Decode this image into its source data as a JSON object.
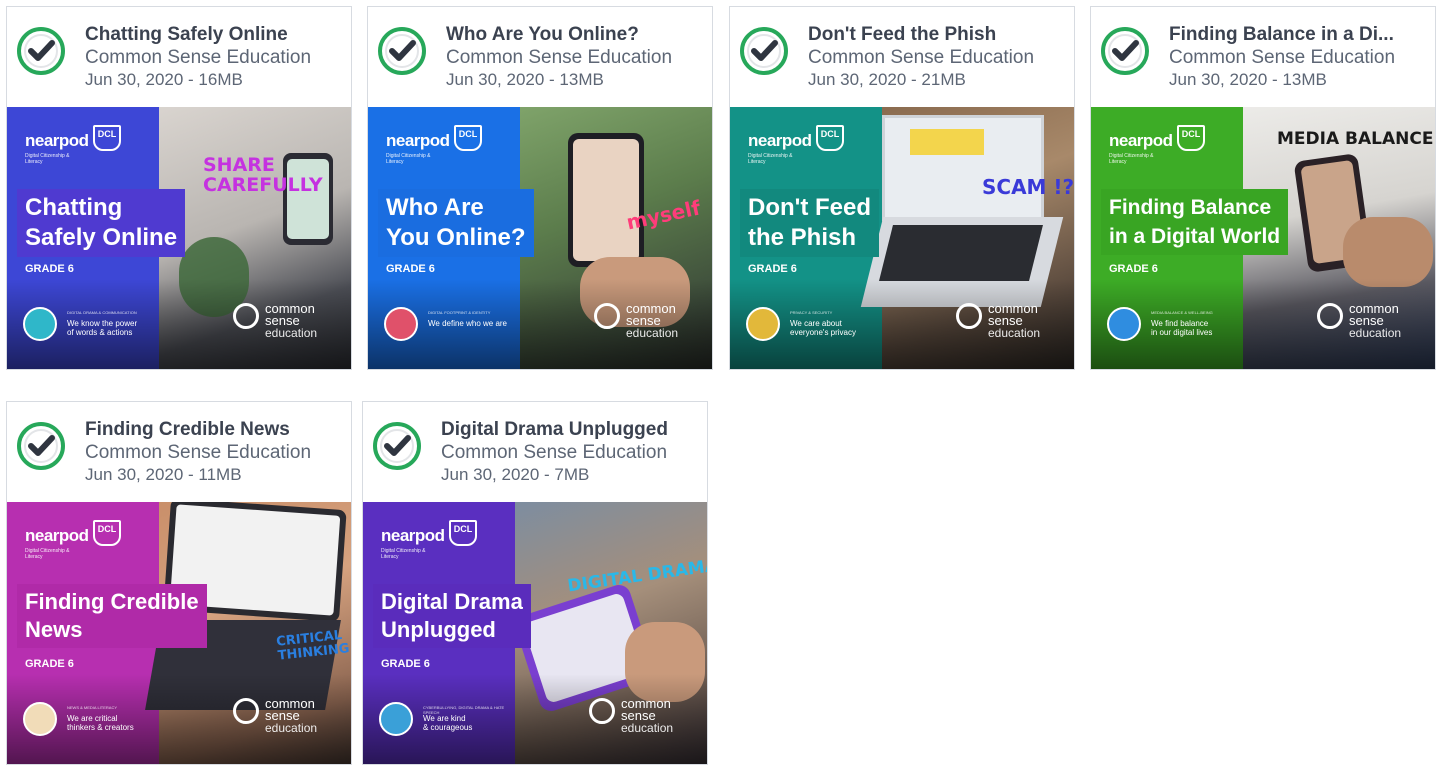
{
  "cards": [
    {
      "title": "Chatting Safely Online",
      "publisher": "Common Sense Education",
      "meta": "Jun 30, 2020 - 16MB",
      "thumb": {
        "brand": "nearpod",
        "badge": "DCL",
        "brand_sub": "Digital Citizenship & Literacy",
        "lesson_title": "Chatting\nSafely Online",
        "grade": "GRADE 6",
        "value_topic": "DIGITAL DRAMA & COMMUNICATION",
        "value_text": "We know the power\nof words & actions",
        "sticker": "SHARE\nCAREFULLY",
        "cs_logo": "common\nsense",
        "cs_sub": "education",
        "panel_color": "#3d47d6",
        "label_color": "#4f3ad0",
        "sticker_color": "#c532e0"
      }
    },
    {
      "title": "Who Are You Online?",
      "publisher": "Common Sense Education",
      "meta": "Jun 30, 2020 - 13MB",
      "thumb": {
        "brand": "nearpod",
        "badge": "DCL",
        "brand_sub": "Digital Citizenship & Literacy",
        "lesson_title": "Who Are\nYou Online?",
        "grade": "GRADE 6",
        "value_topic": "DIGITAL FOOTPRINT & IDENTITY",
        "value_text": "We define who we are",
        "sticker": "myself",
        "cs_logo": "common\nsense",
        "cs_sub": "education",
        "panel_color": "#1a70e6",
        "label_color": "#1a6de0",
        "sticker_color": "#ff3c7a"
      }
    },
    {
      "title": "Don't Feed the Phish",
      "publisher": "Common Sense Education",
      "meta": "Jun 30, 2020 - 21MB",
      "thumb": {
        "brand": "nearpod",
        "badge": "DCL",
        "brand_sub": "Digital Citizenship & Literacy",
        "lesson_title": "Don't Feed\nthe Phish",
        "grade": "GRADE 6",
        "value_topic": "PRIVACY & SECURITY",
        "value_text": "We care about\neveryone's privacy",
        "sticker": "SCAM !?",
        "cs_logo": "common\nsense",
        "cs_sub": "education",
        "panel_color": "#139287",
        "label_color": "#12897e",
        "sticker_color": "#3a3ad8"
      }
    },
    {
      "title": "Finding Balance in a Di...",
      "publisher": "Common Sense Education",
      "meta": "Jun 30, 2020 - 13MB",
      "thumb": {
        "brand": "nearpod",
        "badge": "DCL",
        "brand_sub": "Digital Citizenship & Literacy",
        "lesson_title": "Finding Balance\nin a Digital World",
        "grade": "GRADE 6",
        "value_topic": "MEDIA BALANCE & WELL-BEING",
        "value_text": "We find balance\nin our digital lives",
        "sticker": "MEDIA BALANCE",
        "cs_logo": "common\nsense",
        "cs_sub": "education",
        "panel_color": "#3dac26",
        "label_color": "#39a523",
        "sticker_color": "#1a1a1a"
      }
    },
    {
      "title": "Finding Credible News",
      "publisher": "Common Sense Education",
      "meta": "Jun 30, 2020 - 11MB",
      "thumb": {
        "brand": "nearpod",
        "badge": "DCL",
        "brand_sub": "Digital Citizenship & Literacy",
        "lesson_title": "Finding Credible\nNews",
        "grade": "GRADE 6",
        "value_topic": "NEWS & MEDIA LITERACY",
        "value_text": "We are critical\nthinkers & creators",
        "sticker": "CRITICAL\nTHINKING",
        "cs_logo": "common\nsense",
        "cs_sub": "education",
        "panel_color": "#b72fb0",
        "label_color": "#b02aa8",
        "sticker_color": "#2a7fe0"
      }
    },
    {
      "title": "Digital Drama Unplugged",
      "publisher": "Common Sense Education",
      "meta": "Jun 30, 2020 - 7MB",
      "thumb": {
        "brand": "nearpod",
        "badge": "DCL",
        "brand_sub": "Digital Citizenship & Literacy",
        "lesson_title": "Digital Drama\nUnplugged",
        "grade": "GRADE 6",
        "value_topic": "CYBERBULLYING, DIGITAL DRAMA & HATE SPEECH",
        "value_text": "We are kind\n& courageous",
        "sticker": "DIGITAL DRAMA",
        "cs_logo": "common\nsense",
        "cs_sub": "education",
        "panel_color": "#5a2fc0",
        "label_color": "#5a2cbc",
        "sticker_color": "#2ab8e8"
      }
    }
  ]
}
